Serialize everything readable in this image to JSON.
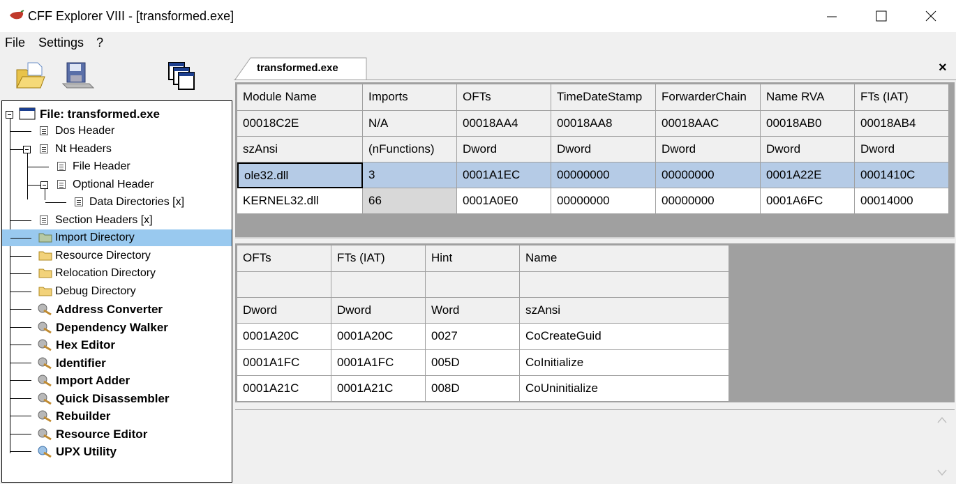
{
  "window": {
    "title": "CFF Explorer VIII - [transformed.exe]",
    "minimize": "–",
    "maximize": "☐",
    "close": "✕"
  },
  "menu": [
    "File",
    "Settings",
    "?"
  ],
  "toolbar": [
    "open-file-icon",
    "save-icon",
    "windows-icon"
  ],
  "tree": {
    "root": "File: transformed.exe",
    "items": [
      {
        "label": "Dos Header"
      },
      {
        "label": "Nt Headers"
      },
      {
        "label": "File Header"
      },
      {
        "label": "Optional Header"
      },
      {
        "label": "Data Directories [x]"
      },
      {
        "label": "Section Headers [x]"
      },
      {
        "label": "Import Directory"
      },
      {
        "label": "Resource Directory"
      },
      {
        "label": "Relocation Directory"
      },
      {
        "label": "Debug Directory"
      },
      {
        "label": "Address Converter"
      },
      {
        "label": "Dependency Walker"
      },
      {
        "label": "Hex Editor"
      },
      {
        "label": "Identifier"
      },
      {
        "label": "Import Adder"
      },
      {
        "label": "Quick Disassembler"
      },
      {
        "label": "Rebuilder"
      },
      {
        "label": "Resource Editor"
      },
      {
        "label": "UPX Utility"
      }
    ]
  },
  "tab": {
    "label": "transformed.exe",
    "close": "×"
  },
  "imports_table": {
    "headers": [
      "Module Name",
      "Imports",
      "OFTs",
      "TimeDateStamp",
      "ForwarderChain",
      "Name RVA",
      "FTs (IAT)"
    ],
    "offsets": [
      "00018C2E",
      "N/A",
      "00018AA4",
      "00018AA8",
      "00018AAC",
      "00018AB0",
      "00018AB4"
    ],
    "types": [
      "szAnsi",
      "(nFunctions)",
      "Dword",
      "Dword",
      "Dword",
      "Dword",
      "Dword"
    ],
    "rows": [
      [
        "ole32.dll",
        "3",
        "0001A1EC",
        "00000000",
        "00000000",
        "0001A22E",
        "0001410C"
      ],
      [
        "KERNEL32.dll",
        "66",
        "0001A0E0",
        "00000000",
        "00000000",
        "0001A6FC",
        "00014000"
      ]
    ]
  },
  "functions_table": {
    "headers": [
      "OFTs",
      "FTs (IAT)",
      "Hint",
      "Name"
    ],
    "offsets": [
      "",
      "",
      "",
      ""
    ],
    "types": [
      "Dword",
      "Dword",
      "Word",
      "szAnsi"
    ],
    "rows": [
      [
        "0001A20C",
        "0001A20C",
        "0027",
        "CoCreateGuid"
      ],
      [
        "0001A1FC",
        "0001A1FC",
        "005D",
        "CoInitialize"
      ],
      [
        "0001A21C",
        "0001A21C",
        "008D",
        "CoUninitialize"
      ]
    ]
  }
}
